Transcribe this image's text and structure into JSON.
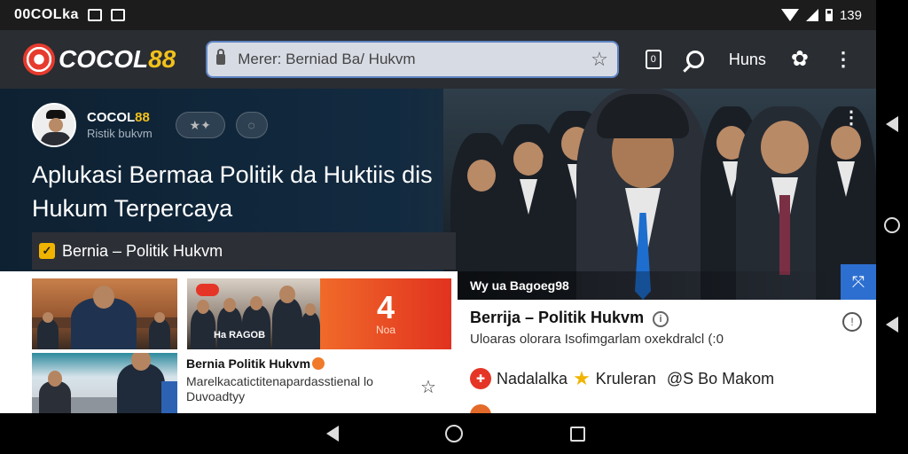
{
  "status": {
    "left_text": "00COLka",
    "right_text": "139"
  },
  "appbar": {
    "logo": {
      "text_main": "COCOL",
      "text_accent": "88"
    },
    "search": {
      "value": "Merer: Berniad Ba/ Hukvm"
    },
    "tools": {
      "tab_label": "0",
      "label": "Huns"
    }
  },
  "hero": {
    "brand": {
      "name_main": "COCOL",
      "name_accent": "88",
      "subtitle": "Ristik bukvm"
    },
    "title": "Aplukasi Bermaa Politik da Huktiis dis Hukum Terpercaya",
    "section_label": "Bernia – Politik Hukvm"
  },
  "grid": {
    "thumb2_overlay": "Ha RAGOB",
    "thumb2_ad": {
      "big": "4",
      "small": "Noa"
    },
    "card": {
      "title": "Bernia Politik Hukvm",
      "desc": "Marelkacatictitenapardasstienal lo Duvoadtyy"
    }
  },
  "article": {
    "caption": "Wy ua Bagoeg98",
    "title": "Berrija – Politik Hukvm",
    "title_info": "i",
    "subtitle": "Uloaras olorara Isofimgarlam oxekdralcl (:0",
    "row": {
      "item1": "Nadalalka",
      "item2": "Kruleran",
      "item3": "@S Bo Makom"
    }
  },
  "colors": {
    "accent": "#f2c21b",
    "brand_red": "#e53526",
    "share_blue": "#2d6fd0"
  },
  "icons": [
    "notification-icon",
    "gallery-icon",
    "wifi-icon",
    "signal-icon",
    "battery-icon",
    "lock-icon",
    "star-icon",
    "tab-icon",
    "search-icon",
    "gear-icon",
    "more-icon",
    "share-icon",
    "info-icon",
    "back-icon",
    "home-icon",
    "recent-icon"
  ]
}
